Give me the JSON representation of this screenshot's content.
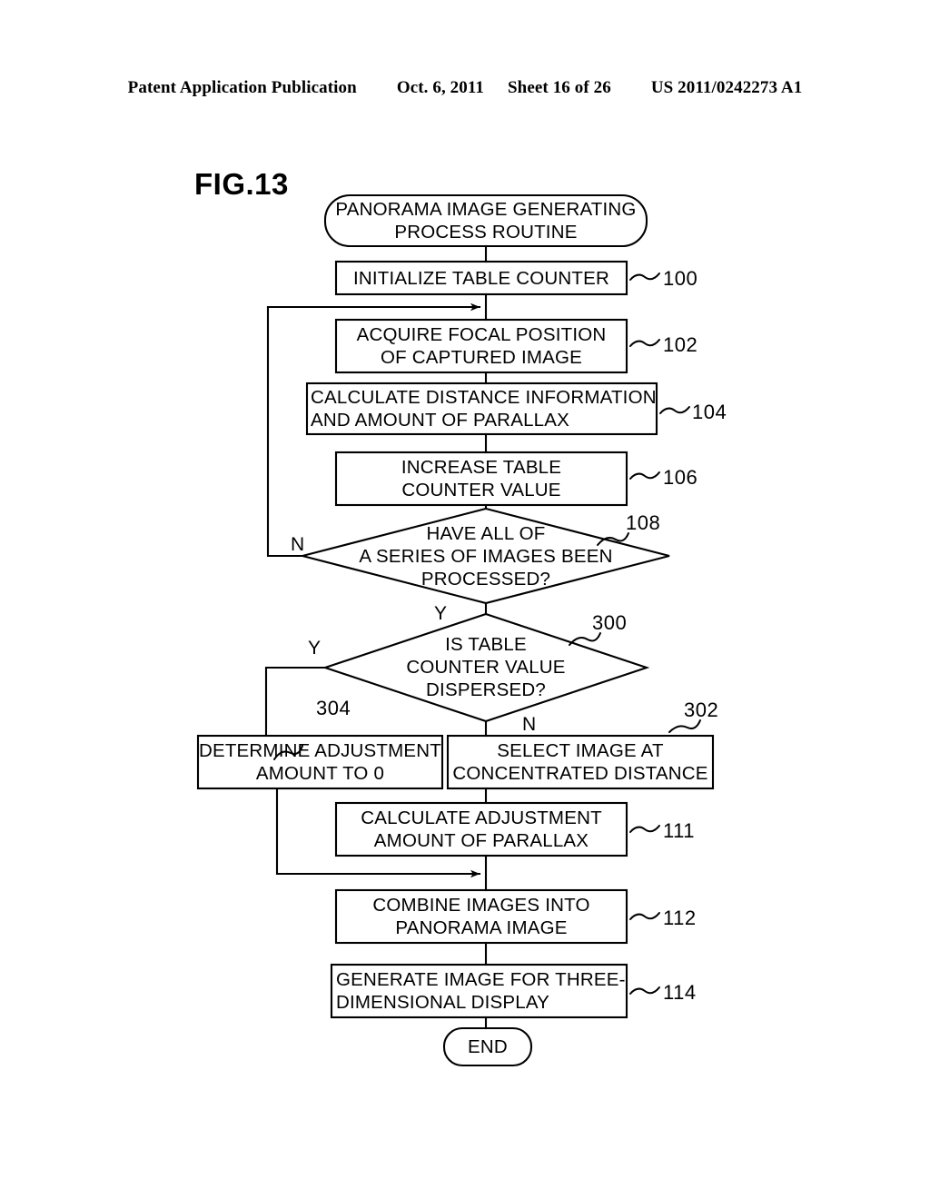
{
  "header": {
    "publication": "Patent Application Publication",
    "date": "Oct. 6, 2011",
    "sheet": "Sheet 16 of 26",
    "docket": "US 2011/0242273 A1"
  },
  "figure": {
    "label": "FIG.13"
  },
  "flowchart": {
    "start": {
      "text": "PANORAMA IMAGE GENERATING\nPROCESS ROUTINE"
    },
    "end": {
      "text": "END"
    },
    "steps": [
      {
        "id": "100",
        "text": "INITIALIZE TABLE COUNTER",
        "ref": "100"
      },
      {
        "id": "102",
        "text": "ACQUIRE FOCAL POSITION\nOF CAPTURED IMAGE",
        "ref": "102"
      },
      {
        "id": "104",
        "text": "CALCULATE DISTANCE INFORMATION\nAND AMOUNT OF PARALLAX",
        "ref": "104"
      },
      {
        "id": "106",
        "text": "INCREASE TABLE\nCOUNTER VALUE",
        "ref": "106"
      },
      {
        "id": "304",
        "text": "DETERMINE ADJUSTMENT\nAMOUNT TO 0",
        "ref": "304"
      },
      {
        "id": "302",
        "text": "SELECT IMAGE AT\nCONCENTRATED DISTANCE",
        "ref": "302"
      },
      {
        "id": "111",
        "text": "CALCULATE ADJUSTMENT\nAMOUNT OF PARALLAX",
        "ref": "111"
      },
      {
        "id": "112",
        "text": "COMBINE IMAGES INTO\nPANORAMA IMAGE",
        "ref": "112"
      },
      {
        "id": "114",
        "text": "GENERATE IMAGE FOR THREE-\nDIMENSIONAL DISPLAY",
        "ref": "114"
      }
    ],
    "decisions": [
      {
        "id": "108",
        "text": "HAVE ALL OF\nA SERIES OF IMAGES BEEN\nPROCESSED?",
        "ref": "108",
        "no_label": "N",
        "yes_label": "Y"
      },
      {
        "id": "300",
        "text": "IS TABLE\nCOUNTER VALUE\nDISPERSED?",
        "ref": "300",
        "no_label": "N",
        "yes_label": "Y",
        "yes_label_left": "Y"
      }
    ],
    "colors": {
      "line": "#000000",
      "background": "#ffffff"
    }
  }
}
